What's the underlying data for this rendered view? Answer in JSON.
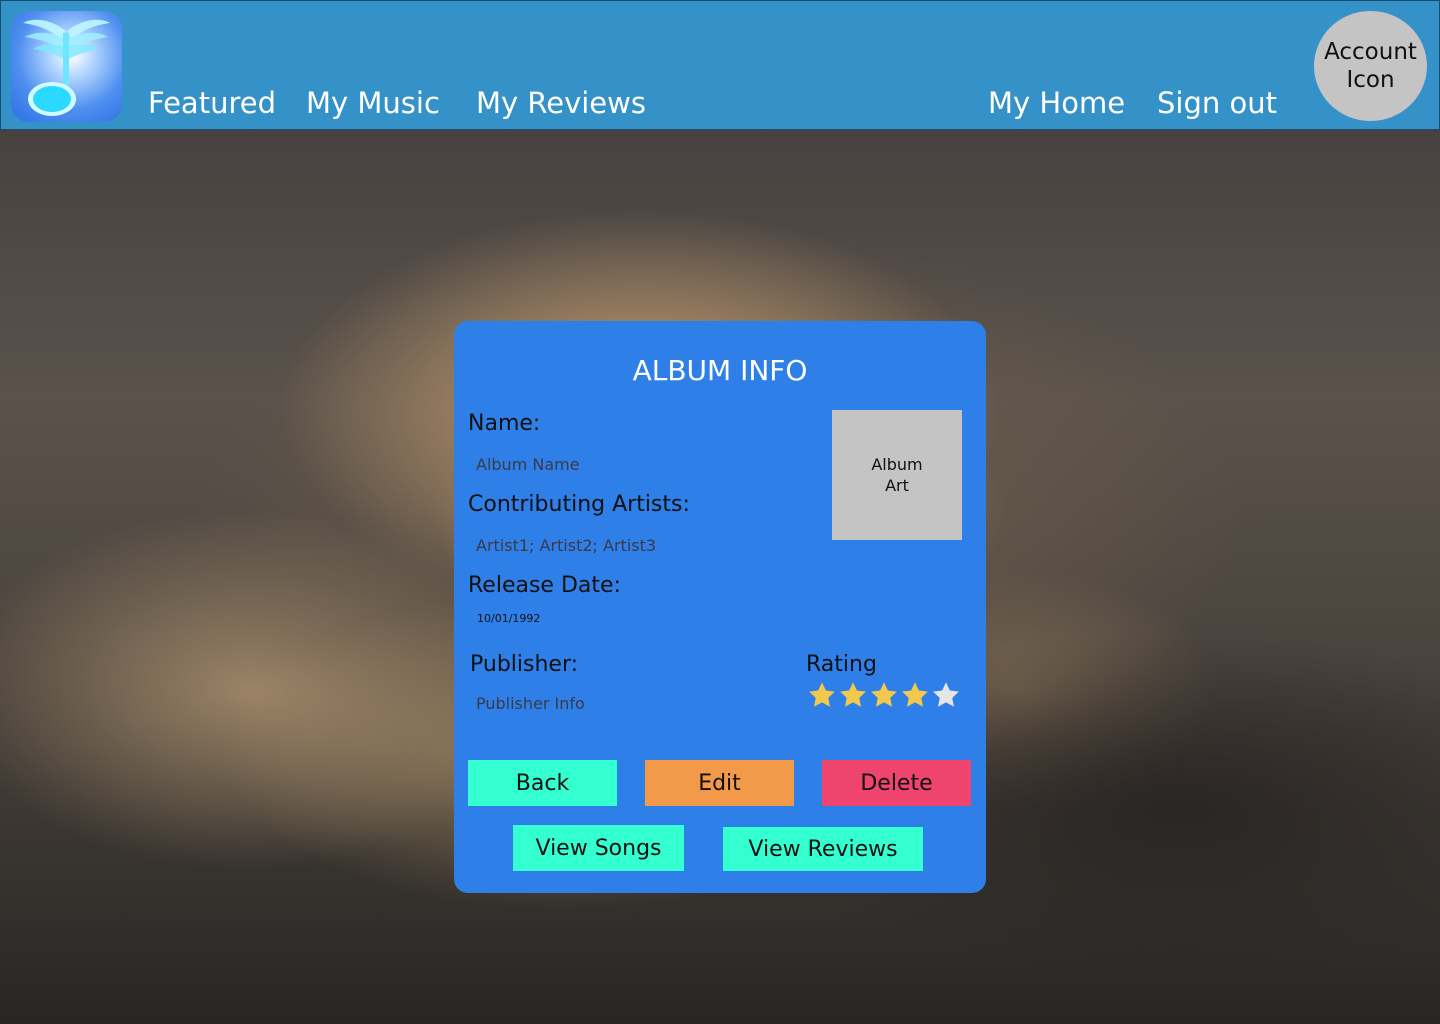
{
  "nav": {
    "left_links": [
      "Featured",
      "My Music",
      "My Reviews"
    ],
    "right_links": [
      "My Home",
      "Sign out"
    ],
    "account_icon_label": "Account Icon"
  },
  "card": {
    "title": "ALBUM INFO",
    "name_label": "Name:",
    "name_value": "Album Name",
    "artists_label": "Contributing Artists:",
    "artists_value": "Artist1; Artist2; Artist3",
    "release_label": "Release Date:",
    "release_value": "10/01/1992",
    "publisher_label": "Publisher:",
    "publisher_value": "Publisher Info",
    "album_art_label": "Album Art",
    "rating_label": "Rating",
    "rating": {
      "value": 4,
      "max": 5
    }
  },
  "buttons": {
    "back": "Back",
    "edit": "Edit",
    "delete": "Delete",
    "view_songs": "View Songs",
    "view_reviews": "View Reviews"
  },
  "colors": {
    "topbar": "#3592c8",
    "card": "#2f7fe8",
    "teal_button": "#33ffd0",
    "edit_button": "#f2994a",
    "delete_button": "#ee446e",
    "star_filled": "#f2c94c",
    "star_empty": "#e6e6e6"
  }
}
